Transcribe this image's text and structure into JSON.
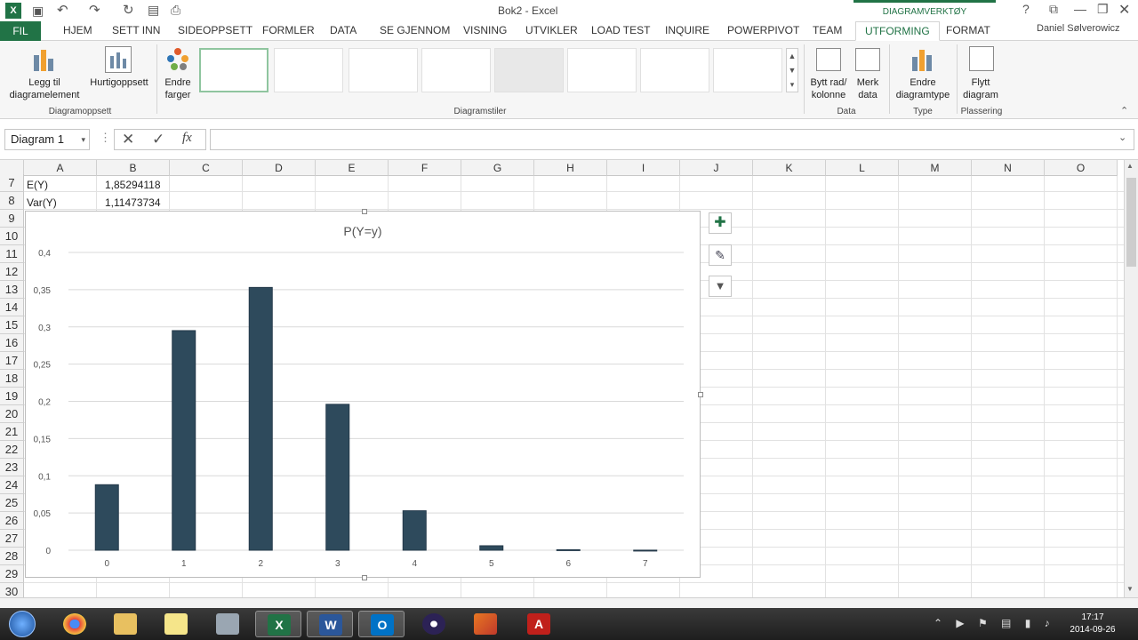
{
  "window": {
    "title": "Bok2 - Excel",
    "context_group": "DIAGRAMVERKTØY",
    "user": "Daniel Sølverowicz"
  },
  "tabs": [
    {
      "label": "FIL"
    },
    {
      "label": "HJEM"
    },
    {
      "label": "SETT INN"
    },
    {
      "label": "SIDEOPPSETT"
    },
    {
      "label": "FORMLER"
    },
    {
      "label": "DATA"
    },
    {
      "label": "SE GJENNOM"
    },
    {
      "label": "VISNING"
    },
    {
      "label": "UTVIKLER"
    },
    {
      "label": "LOAD TEST"
    },
    {
      "label": "INQUIRE"
    },
    {
      "label": "POWERPIVOT"
    },
    {
      "label": "TEAM"
    },
    {
      "label": "UTFORMING"
    },
    {
      "label": "FORMAT"
    }
  ],
  "ribbon": {
    "legg_til_1": "Legg til",
    "legg_til_2": "diagramelement",
    "hurtig": "Hurtigoppsett",
    "endre_farger_1": "Endre",
    "endre_farger_2": "farger",
    "group_oppsett": "Diagramoppsett",
    "group_stiler": "Diagramstiler",
    "bytt_1": "Bytt rad/",
    "bytt_2": "kolonne",
    "merk_1": "Merk",
    "merk_2": "data",
    "group_data": "Data",
    "endre_type_1": "Endre",
    "endre_type_2": "diagramtype",
    "group_type": "Type",
    "flytt_1": "Flytt",
    "flytt_2": "diagram",
    "group_plassering": "Plassering"
  },
  "formula_bar": {
    "name_box": "Diagram 1",
    "fx": "fx",
    "value": ""
  },
  "columns": [
    "A",
    "B",
    "C",
    "D",
    "E",
    "F",
    "G",
    "H",
    "I",
    "J",
    "K",
    "L",
    "M",
    "N",
    "O"
  ],
  "rows": [
    "7",
    "8",
    "9",
    "10",
    "11",
    "12",
    "13",
    "14",
    "15",
    "16",
    "17",
    "18",
    "19",
    "20",
    "21",
    "22",
    "23",
    "24",
    "25",
    "26",
    "27",
    "28",
    "29",
    "30"
  ],
  "cells": {
    "A7": "E(Y)",
    "B7": "1,85294118",
    "A8": "Var(Y)",
    "B8": "1,11473734"
  },
  "chart_data": {
    "type": "bar",
    "title": "P(Y=y)",
    "categories": [
      "0",
      "1",
      "2",
      "3",
      "4",
      "5",
      "6",
      "7"
    ],
    "values": [
      0.088,
      0.295,
      0.353,
      0.196,
      0.053,
      0.006,
      0.0007,
      0.0001
    ],
    "ylim": [
      0,
      0.4
    ],
    "yticks": [
      "0",
      "0,05",
      "0,1",
      "0,15",
      "0,2",
      "0,25",
      "0,3",
      "0,35",
      "0,4"
    ],
    "grid": true,
    "legend": "none",
    "bar_color": "#2e4a5c"
  },
  "taskbar": {
    "time": "17:17",
    "date": "2014-09-26"
  },
  "colors": {
    "accent": "#217346",
    "file_tab": "#217346"
  }
}
